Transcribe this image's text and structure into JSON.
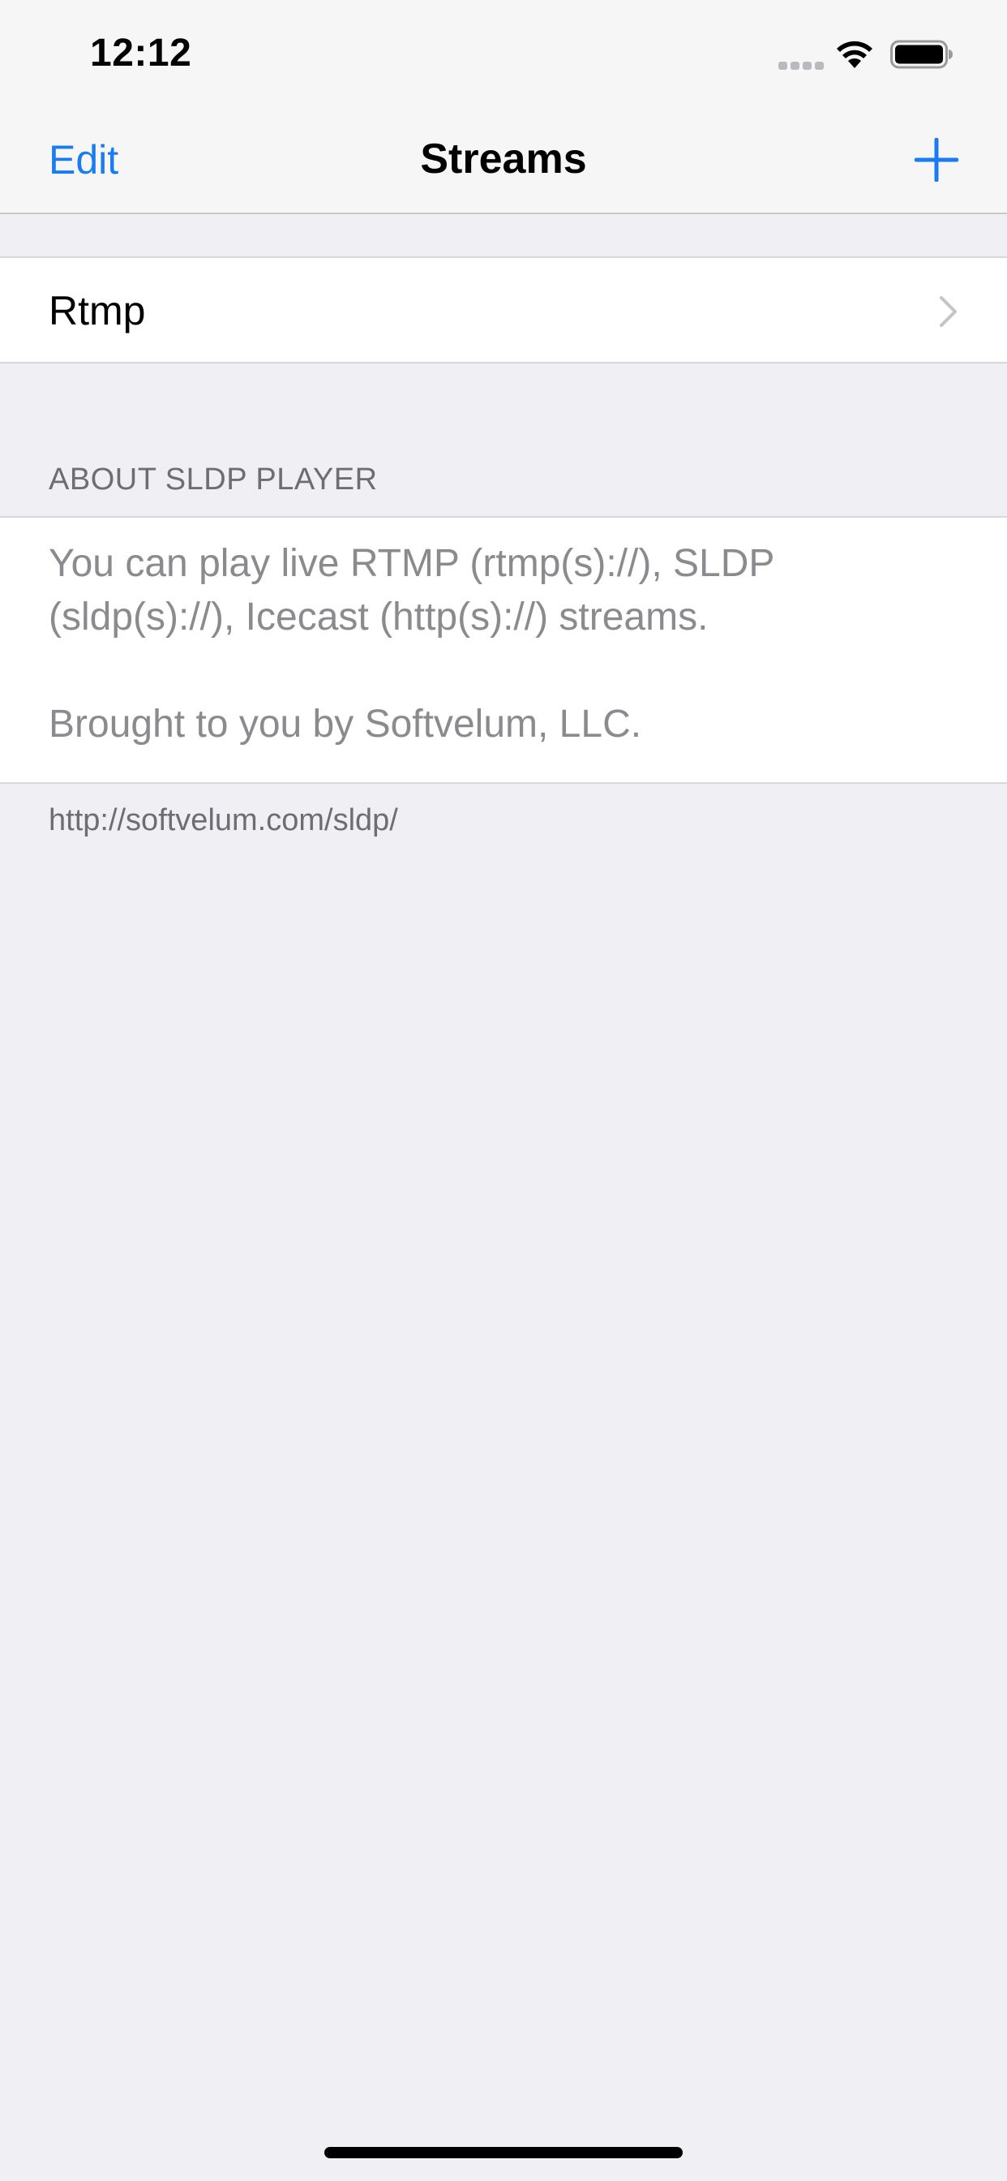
{
  "status_bar": {
    "time": "12:12",
    "signal_icon": "cellular-signal-icon",
    "wifi_icon": "wifi-icon",
    "battery_icon": "battery-icon"
  },
  "nav_bar": {
    "edit_label": "Edit",
    "title": "Streams",
    "add_icon": "plus-icon"
  },
  "streams": {
    "items": [
      {
        "label": "Rtmp",
        "accessory_icon": "chevron-right-icon"
      }
    ]
  },
  "about": {
    "header": "ABOUT SLDP PLAYER",
    "description": "You can play live RTMP (rtmp(s)://), SLDP (sldp(s)://), Icecast (http(s)://) streams.",
    "credit": "Brought to you by Softvelum, LLC.",
    "footer_link": "http://softvelum.com/sldp/"
  },
  "colors": {
    "accent": "#1a7cf0",
    "background": "#efeff4",
    "secondary_text": "#8a8a8f"
  }
}
